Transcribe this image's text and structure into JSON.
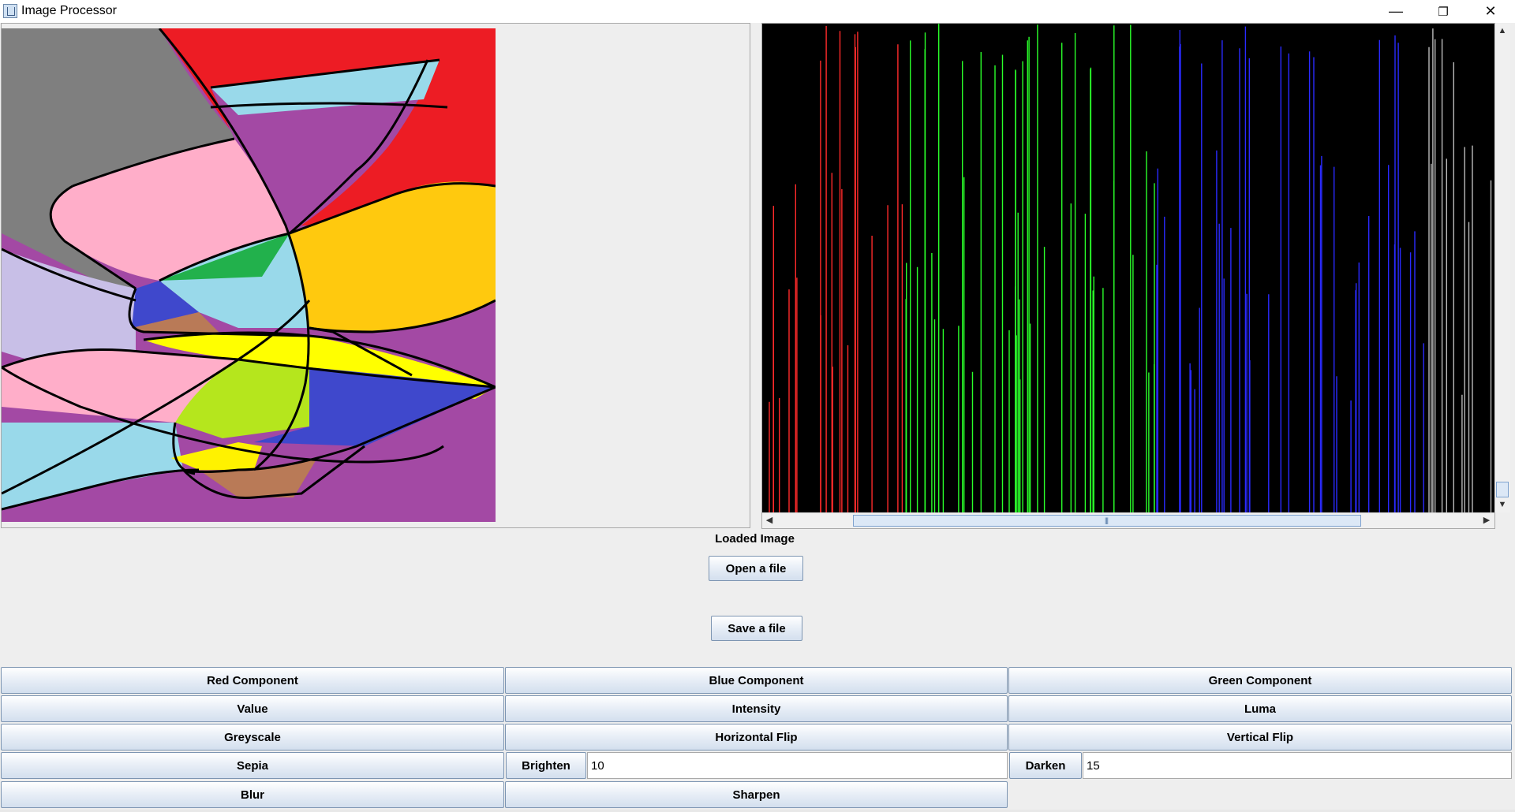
{
  "window": {
    "title": "Image Processor",
    "minimize_glyph": "—",
    "restore_glyph": "❐",
    "close_glyph": "✕"
  },
  "image_panel": {
    "caption": "Loaded Image"
  },
  "histogram": {
    "background": "#000000",
    "series_colors": {
      "red": "#ff2a2a",
      "green": "#2aff2a",
      "blue": "#2a2aff",
      "intensity": "#bbbbbb"
    }
  },
  "file_buttons": {
    "open_label": "Open a file",
    "save_label": "Save a file"
  },
  "operations": {
    "red_component": "Red Component",
    "blue_component": "Blue Component",
    "green_component": "Green Component",
    "value": "Value",
    "intensity": "Intensity",
    "luma": "Luma",
    "greyscale": "Greyscale",
    "horizontal_flip": "Horizontal Flip",
    "vertical_flip": "Vertical Flip",
    "sepia": "Sepia",
    "brighten": "Brighten",
    "brighten_amount": "10",
    "darken": "Darken",
    "darken_amount": "15",
    "blur": "Blur",
    "sharpen": "Sharpen"
  }
}
